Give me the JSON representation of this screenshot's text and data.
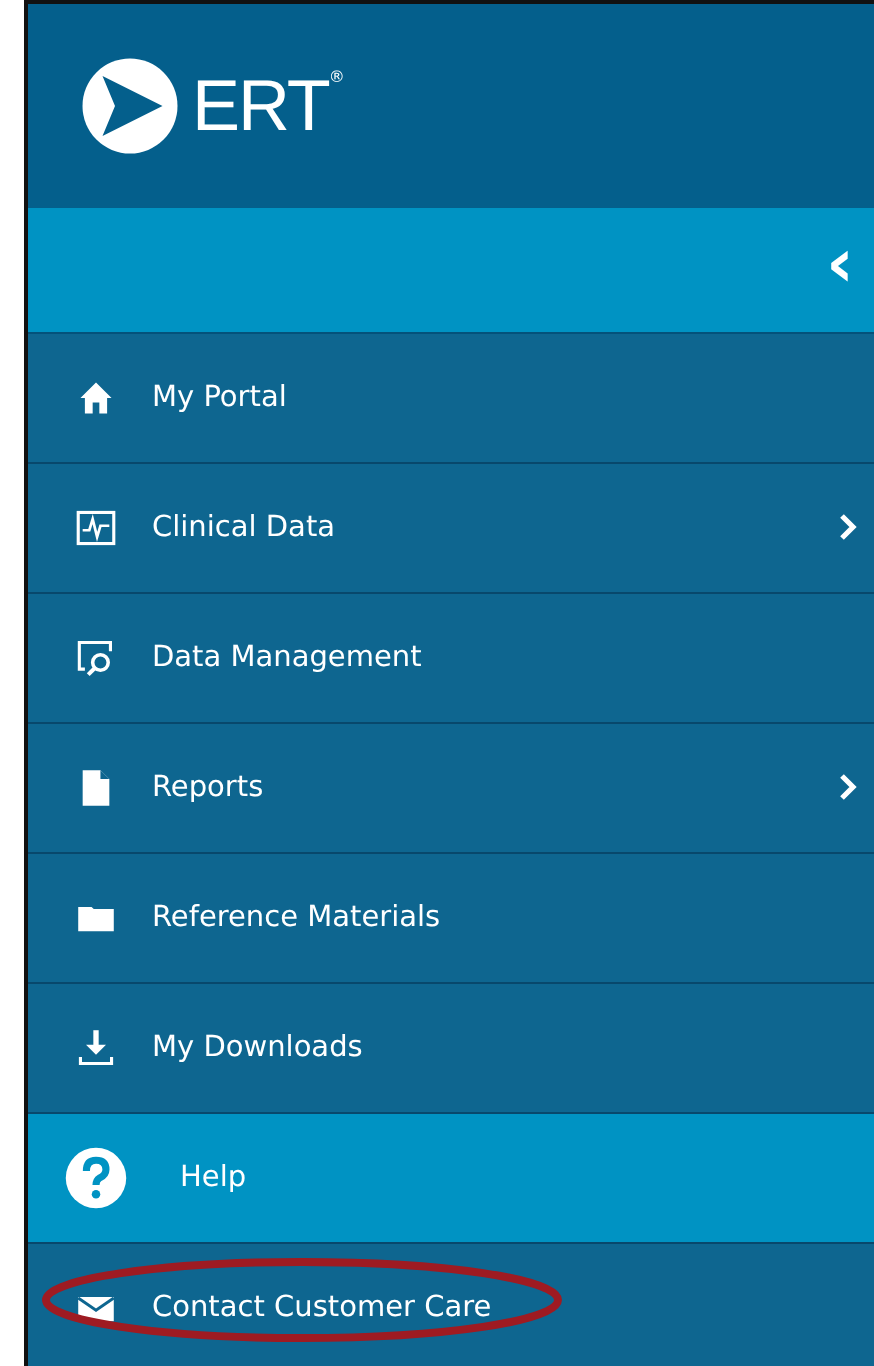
{
  "logo": {
    "text": "ERT",
    "mark": "®"
  },
  "collapse_button": {
    "label": "‹"
  },
  "menu": [
    {
      "kind": "home",
      "label": "My Portal",
      "submenu": false,
      "selected": false,
      "circled": false
    },
    {
      "kind": "chart",
      "label": "Clinical Data",
      "submenu": true,
      "selected": false,
      "circled": false
    },
    {
      "kind": "search",
      "label": "Data Management",
      "submenu": false,
      "selected": false,
      "circled": false
    },
    {
      "kind": "document",
      "label": "Reports",
      "submenu": true,
      "selected": false,
      "circled": false
    },
    {
      "kind": "folder",
      "label": "Reference Materials",
      "submenu": false,
      "selected": false,
      "circled": false
    },
    {
      "kind": "download",
      "label": "My Downloads",
      "submenu": false,
      "selected": false,
      "circled": false
    },
    {
      "kind": "help",
      "label": "Help",
      "submenu": false,
      "selected": true,
      "circled": false
    },
    {
      "kind": "mail",
      "label": "Contact Customer Care",
      "submenu": false,
      "selected": false,
      "circled": true
    }
  ]
}
